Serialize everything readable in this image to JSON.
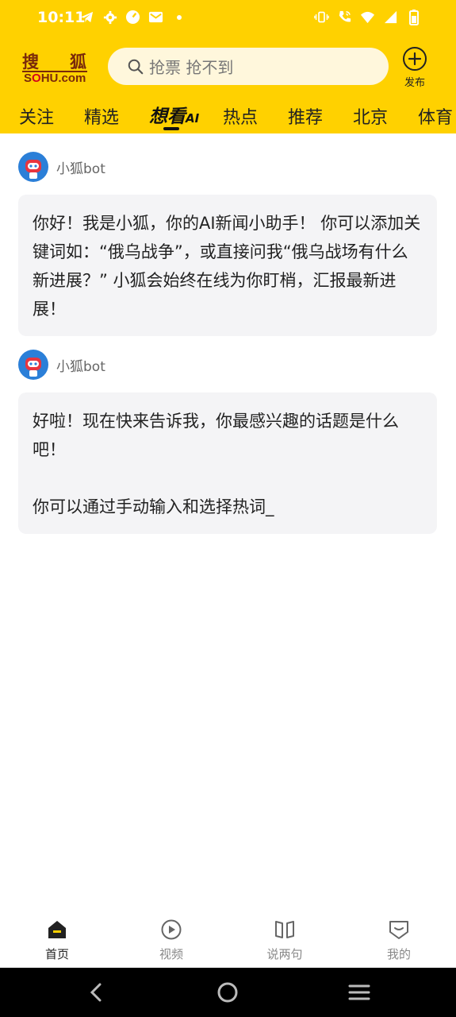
{
  "status_bar": {
    "time": "10:11",
    "left_icons": [
      "telegram-icon",
      "gear-icon",
      "speed-icon",
      "mail-icon",
      "dot-icon"
    ],
    "right_icons": [
      "vibrate-icon",
      "wifi-calling-icon",
      "wifi-icon",
      "signal-icon",
      "battery-icon"
    ]
  },
  "header": {
    "logo_top": [
      "搜",
      "狐"
    ],
    "logo_bottom_pre": "S",
    "logo_bottom_o": "O",
    "logo_bottom_post": "HU.com",
    "search_placeholder": "抢票 抢不到",
    "publish_label": "发布",
    "accent_color": "#FFD100"
  },
  "tabs": [
    {
      "label": "关注"
    },
    {
      "label": "精选"
    },
    {
      "label": "想看",
      "badge": "AI",
      "active": true
    },
    {
      "label": "热点"
    },
    {
      "label": "推荐"
    },
    {
      "label": "北京"
    },
    {
      "label": "体育"
    }
  ],
  "messages": [
    {
      "sender": "小狐bot",
      "text": "你好！我是小狐，你的AI新闻小助手！ 你可以添加关键词如：“俄乌战争”，或直接问我“俄乌战场有什么新进展？” 小狐会始终在线为你盯梢，汇报最新进展！"
    },
    {
      "sender": "小狐bot",
      "text": "好啦！现在快来告诉我，你最感兴趣的话题是什么吧！\n\n你可以通过手动输入和选择热词_"
    }
  ],
  "bottom_nav": [
    {
      "label": "首页",
      "icon": "home-icon",
      "active": true
    },
    {
      "label": "视频",
      "icon": "play-icon"
    },
    {
      "label": "说两句",
      "icon": "book-icon"
    },
    {
      "label": "我的",
      "icon": "profile-icon"
    }
  ]
}
